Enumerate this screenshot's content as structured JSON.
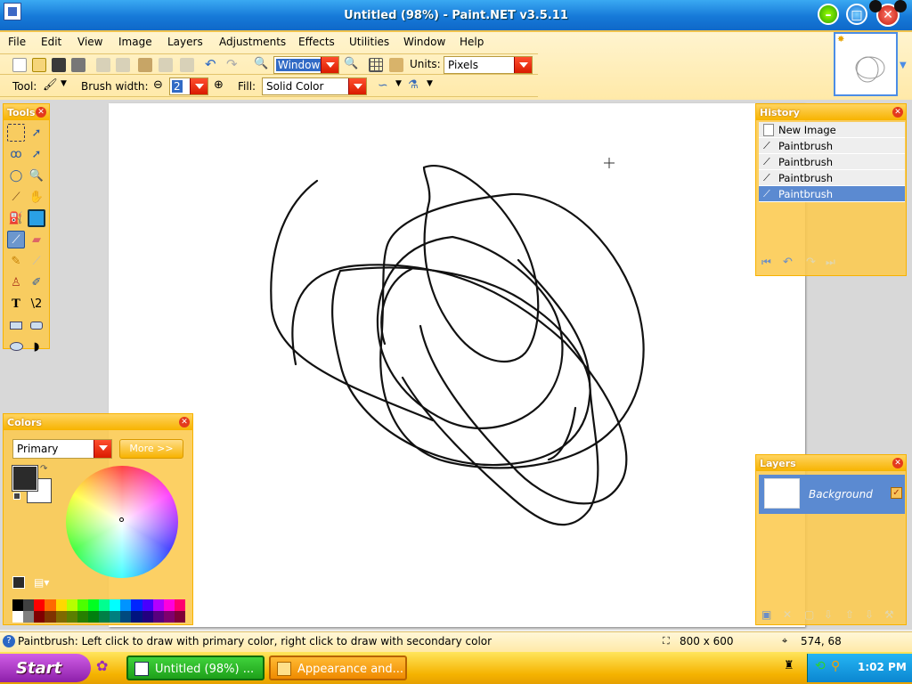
{
  "window": {
    "title": "Untitled (98%) - Paint.NET v3.5.11"
  },
  "menu": [
    "File",
    "Edit",
    "View",
    "Image",
    "Layers",
    "Adjustments",
    "Effects",
    "Utilities",
    "Window",
    "Help"
  ],
  "toolbar": {
    "zoom_value": "Window",
    "units_label": "Units:",
    "units_value": "Pixels"
  },
  "toolbar2": {
    "tool_label": "Tool:",
    "brush_width_label": "Brush width:",
    "brush_width_value": "2",
    "fill_label": "Fill:",
    "fill_value": "Solid Color"
  },
  "tools_panel": {
    "title": "Tools"
  },
  "colors_panel": {
    "title": "Colors",
    "mode": "Primary",
    "more_button": "More >>",
    "primary_color": "#2b2b2b",
    "secondary_color": "#ffffff"
  },
  "history_panel": {
    "title": "History",
    "items": [
      "New Image",
      "Paintbrush",
      "Paintbrush",
      "Paintbrush",
      "Paintbrush"
    ]
  },
  "layers_panel": {
    "title": "Layers",
    "layer_name": "Background"
  },
  "status": {
    "hint": "Paintbrush: Left click to draw with primary color, right click to draw with secondary color",
    "image_size": "800 x 600",
    "cursor_pos": "574, 68"
  },
  "taskbar": {
    "start": "Start",
    "tasks": [
      "Untitled (98%) ...",
      "Appearance and..."
    ],
    "clock": "1:02 PM"
  },
  "colors": {
    "accent": "#f7b300",
    "title_blue": "#1679d8",
    "selection_blue": "#5b8ad1"
  }
}
